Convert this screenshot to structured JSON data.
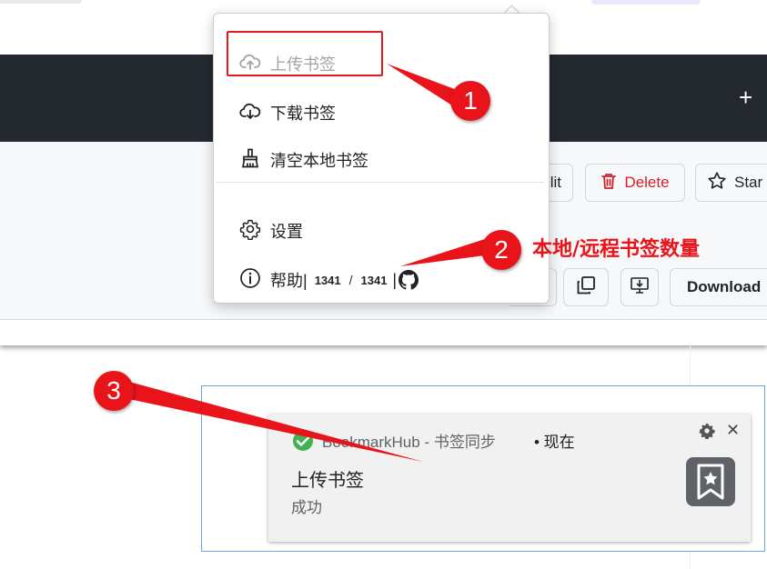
{
  "repo_toolbar": {
    "edit_label_partial": "lit",
    "delete_label": "Delete",
    "star_label": "Star",
    "download_label": "Download"
  },
  "popup": {
    "upload_label": "上传书签",
    "download_label": "下载书签",
    "clear_label": "清空本地书签",
    "settings_label": "设置",
    "help_label": "帮助|",
    "local_count": "1341",
    "count_separator": "/",
    "remote_count": "1341",
    "trailing_pipe": "|"
  },
  "annotations": {
    "badge_1": "1",
    "badge_2": "2",
    "badge_3": "3",
    "label_2": "本地/远程书签数量",
    "highlight_color": "#e21b1b"
  },
  "notification": {
    "source": "BookmarkHub - 书签同步",
    "time": "• 现在",
    "title": "上传书签",
    "body": "成功",
    "close_glyph": "✕"
  },
  "header": {
    "plus_glyph": "+"
  },
  "colors": {
    "github_header": "#24292f",
    "danger": "#cf222e",
    "annotation_red": "#e8141a"
  }
}
